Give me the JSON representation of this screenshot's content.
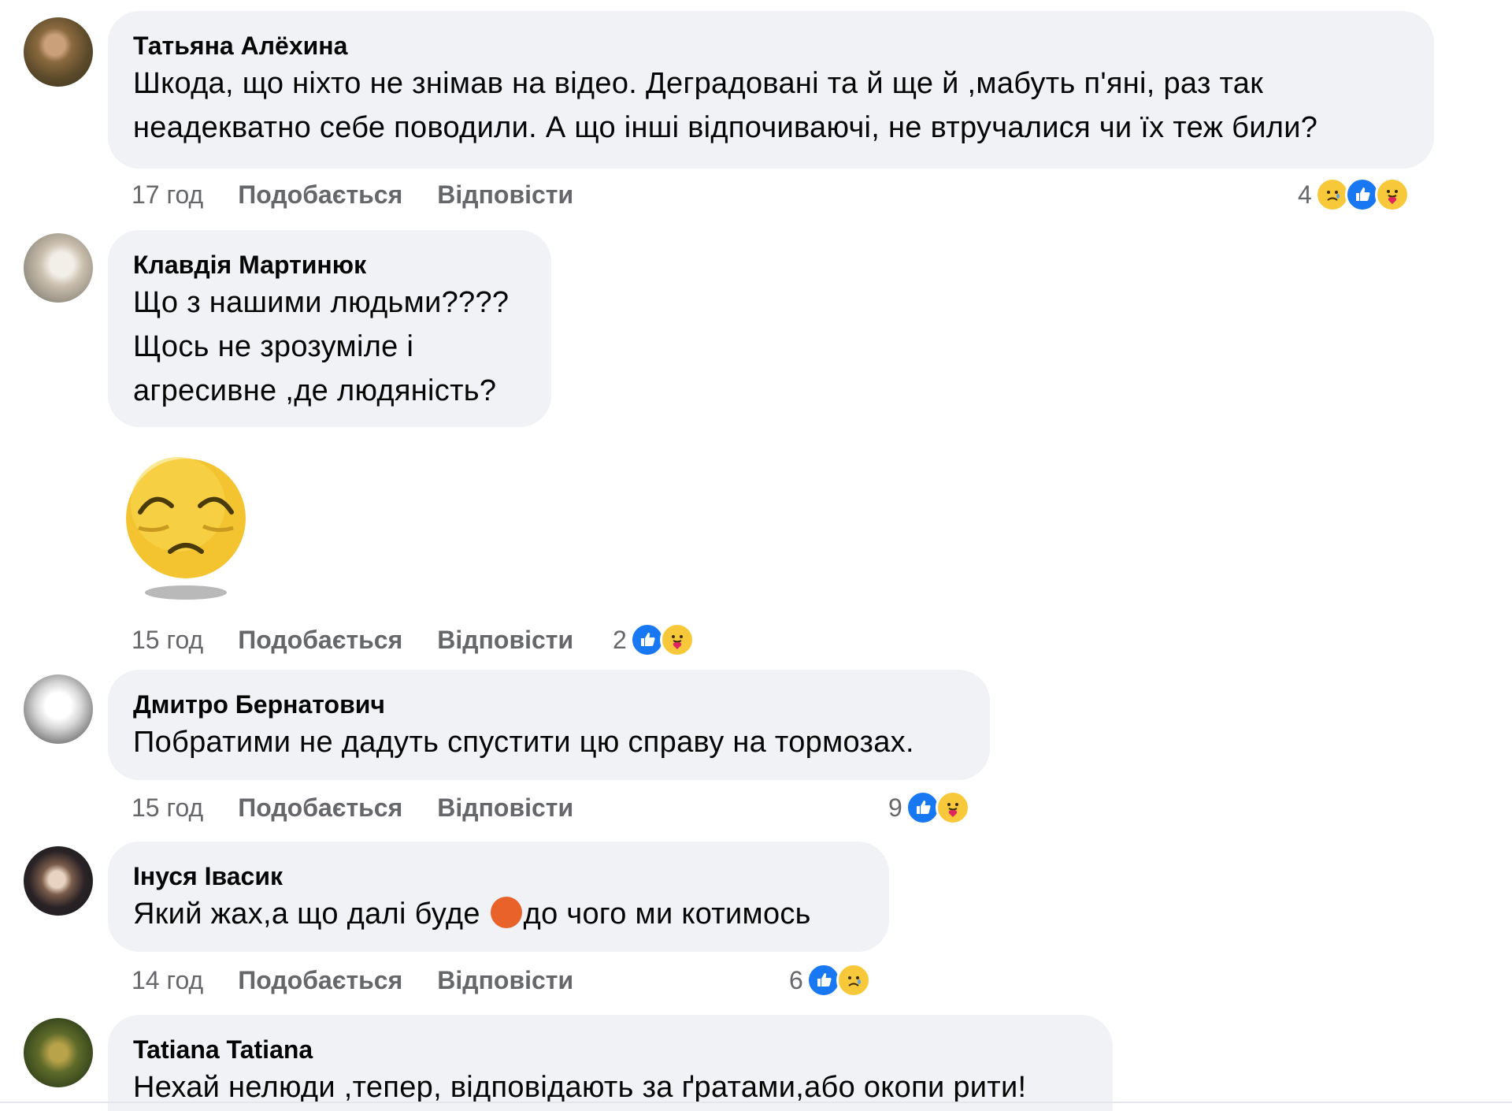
{
  "comments": [
    {
      "author": "Татьяна Алёхина",
      "lines": [
        "Шкода, що ніхто не знімав на відео. Деградовані та й ще й ,мабуть п'яні, раз так",
        "неадекватно себе поводили. А що інші відпочиваючі, не втручалися чи їх теж били?"
      ],
      "time": "17 год",
      "like": "Подобається",
      "reply": "Відповісти",
      "reactions": {
        "count": "4",
        "icons": [
          "sad-icon",
          "like-icon",
          "care-icon"
        ]
      }
    },
    {
      "author": "Клавдія Мартинюк",
      "lines": [
        "Що з нашими людьми????",
        "Щось не зрозуміле і",
        "агресивне ,де людяність?"
      ],
      "sticker": "pleading-face-sticker",
      "time": "15 год",
      "like": "Подобається",
      "reply": "Відповісти",
      "reactions": {
        "count": "2",
        "icons": [
          "like-icon",
          "care-icon"
        ]
      }
    },
    {
      "author": "Дмитро Бернатович",
      "lines": [
        "Побратими не дадуть спустити цю справу на тормозах."
      ],
      "time": "15 год",
      "like": "Подобається",
      "reply": "Відповісти",
      "reactions": {
        "count": "9",
        "icons": [
          "like-icon",
          "care-icon"
        ]
      }
    },
    {
      "author": "Інуся Івасик",
      "text_before": "Який жах,а що далі буде ",
      "inline_emoji": "angry-face-icon",
      "text_after": "до чого ми котимось",
      "time": "14 год",
      "like": "Подобається",
      "reply": "Відповісти",
      "reactions": {
        "count": "6",
        "icons": [
          "like-icon",
          "sad-icon"
        ]
      }
    },
    {
      "author": "Tatiana Tatiana",
      "lines": [
        "Нехай нелюди ,тепер, відповідають за ґратами,або окопи рити!"
      ]
    }
  ],
  "colors": {
    "bubble": "#f0f2f5",
    "meta": "#65676b",
    "like_blue": "#1877f2",
    "emoji_yellow": "#f7c93a"
  }
}
